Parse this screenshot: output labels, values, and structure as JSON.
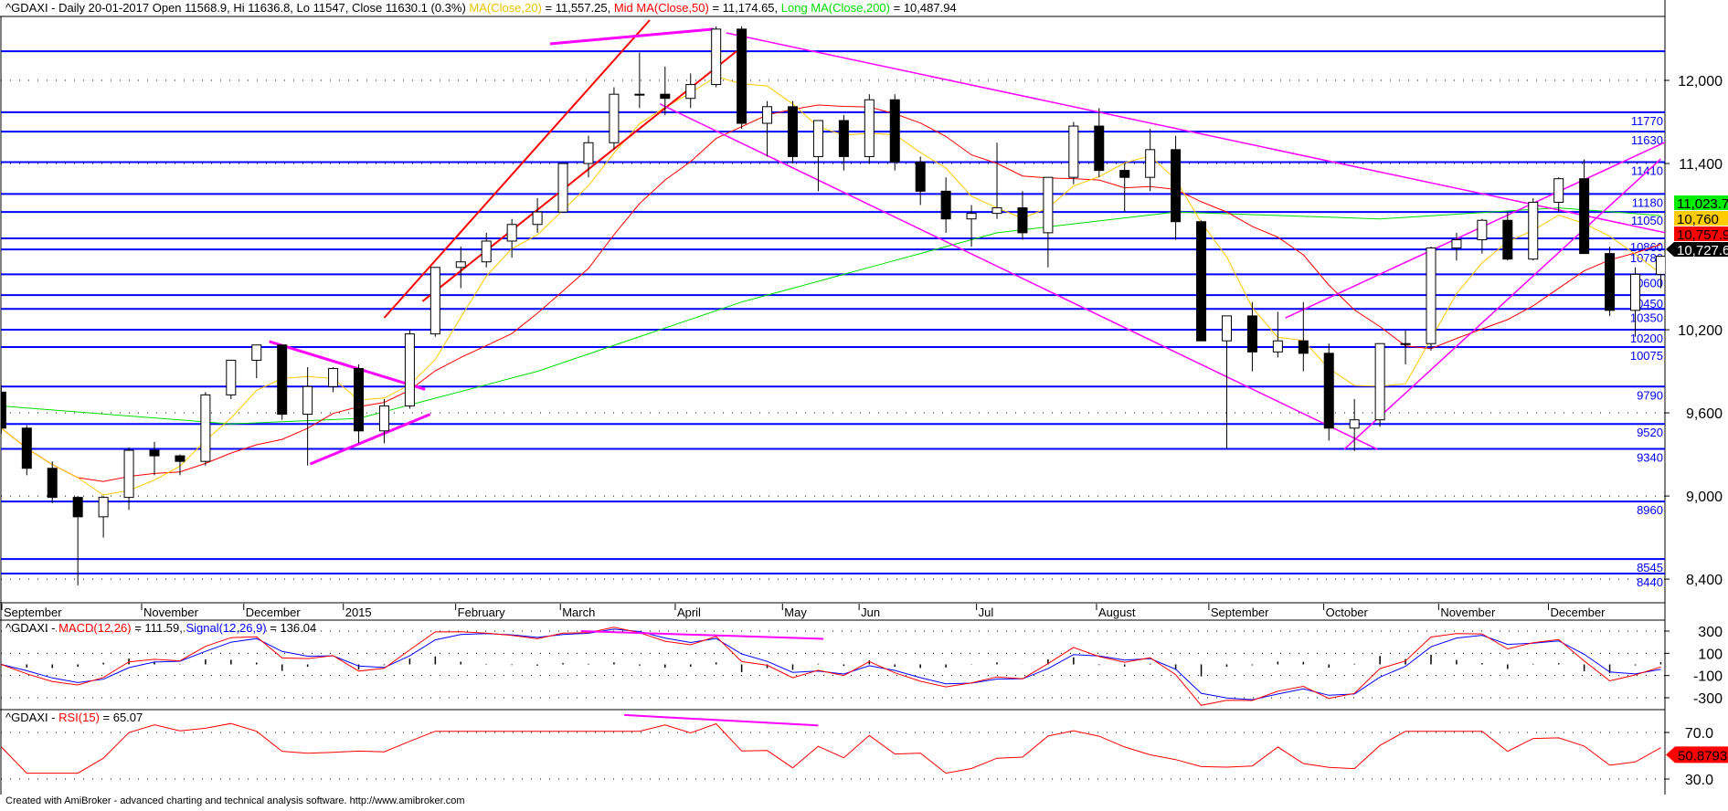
{
  "header": {
    "symbol_info": "^GDAXI - Daily 20-01-2017 Open 11568.9, Hi 11636.8, Lo 11547, Close 11630.1 (0.3%)",
    "ma20_label": "MA(Close,20)",
    "ma20_value": " = 11,557.25, ",
    "ma50_label": "Mid MA(Close,50)",
    "ma50_value": " = 11,174.65, ",
    "ma200_label": "Long MA(Close,200)",
    "ma200_value": " = 10,487.94"
  },
  "macd_header": {
    "prefix": "^GDAXI - ",
    "macd_label": "MACD(12,26)",
    "macd_value": " = 111.59, ",
    "signal_label": "Signal(12,26,9)",
    "signal_value": " = 136.04"
  },
  "rsi_header": {
    "prefix": "^GDAXI - ",
    "rsi_label": "RSI(15)",
    "rsi_value": " = 65.07"
  },
  "footer": "Created with AmiBroker - advanced charting and technical analysis software. http://www.amibroker.com",
  "colors": {
    "support": "#0000ff",
    "trend": "#ff00ff",
    "trend_red": "#ff0000",
    "ma20": "#ffc800",
    "ma50": "#ff0000",
    "ma200": "#00dd00",
    "macd": "#ff0000",
    "signal": "#0000ff",
    "rsi": "#ff0000"
  },
  "chart_data": {
    "type": "candlestick",
    "title": "^GDAXI - Daily",
    "period_unit": "week",
    "months": [
      {
        "label": "September",
        "week": 0.7
      },
      {
        "label": "November",
        "week": 7
      },
      {
        "label": "December",
        "week": 11
      },
      {
        "label": "2015",
        "week": 14.9
      },
      {
        "label": "February",
        "week": 19.3
      },
      {
        "label": "March",
        "week": 23.4
      },
      {
        "label": "April",
        "week": 27.9
      },
      {
        "label": "May",
        "week": 32.1
      },
      {
        "label": "Jun",
        "week": 35.1
      },
      {
        "label": "Jul",
        "week": 39.7
      },
      {
        "label": "August",
        "week": 44.4
      },
      {
        "label": "September",
        "week": 48.8
      },
      {
        "label": "October",
        "week": 53.3
      },
      {
        "label": "November",
        "week": 57.8
      },
      {
        "label": "December",
        "week": 62.1
      }
    ],
    "ohlc": [
      [
        9750,
        9800,
        9450,
        9490
      ],
      [
        9490,
        9510,
        9150,
        9200
      ],
      [
        9200,
        9250,
        8950,
        8990
      ],
      [
        8990,
        9000,
        8355,
        8850
      ],
      [
        8850,
        9000,
        8700,
        8990
      ],
      [
        8990,
        9350,
        8900,
        9330
      ],
      [
        9330,
        9390,
        9150,
        9290
      ],
      [
        9290,
        9300,
        9150,
        9250
      ],
      [
        9250,
        9750,
        9220,
        9730
      ],
      [
        9730,
        9980,
        9700,
        9980
      ],
      [
        9980,
        10090,
        9850,
        10090
      ],
      [
        10090,
        10090,
        9550,
        9590
      ],
      [
        9590,
        9930,
        9220,
        9790
      ],
      [
        9790,
        9930,
        9750,
        9920
      ],
      [
        9920,
        9950,
        9380,
        9470
      ],
      [
        9470,
        9700,
        9380,
        9650
      ],
      [
        9650,
        10200,
        9630,
        10170
      ],
      [
        10170,
        10650,
        10150,
        10650
      ],
      [
        10650,
        10800,
        10500,
        10690
      ],
      [
        10690,
        10900,
        10650,
        10840
      ],
      [
        10840,
        11000,
        10720,
        10960
      ],
      [
        10960,
        11150,
        10900,
        11050
      ],
      [
        11050,
        11400,
        11050,
        11400
      ],
      [
        11400,
        11600,
        11300,
        11550
      ],
      [
        11550,
        11950,
        11500,
        11900
      ],
      [
        11900,
        12200,
        11800,
        11900
      ],
      [
        11900,
        12100,
        11750,
        11870
      ],
      [
        11870,
        12050,
        11800,
        11970
      ],
      [
        11970,
        12390,
        11950,
        12370
      ],
      [
        12370,
        12390,
        11650,
        11690
      ],
      [
        11690,
        11850,
        11450,
        11810
      ],
      [
        11810,
        11850,
        11400,
        11450
      ],
      [
        11450,
        11500,
        11200,
        11710
      ],
      [
        11710,
        11750,
        11350,
        11450
      ],
      [
        11450,
        11900,
        11400,
        11860
      ],
      [
        11860,
        11900,
        11350,
        11410
      ],
      [
        11410,
        11450,
        11100,
        11200
      ],
      [
        11200,
        11300,
        10900,
        11000
      ],
      [
        11000,
        11100,
        10800,
        11040
      ],
      [
        11040,
        11550,
        11000,
        11080
      ],
      [
        11080,
        11200,
        10850,
        10900
      ],
      [
        10900,
        11300,
        10650,
        11300
      ],
      [
        11300,
        11700,
        11250,
        11670
      ],
      [
        11670,
        11800,
        11300,
        11350
      ],
      [
        11350,
        11400,
        11050,
        11300
      ],
      [
        11300,
        11650,
        11200,
        11500
      ],
      [
        11500,
        11600,
        10850,
        10980
      ],
      [
        10980,
        10990,
        10120,
        10120
      ],
      [
        10120,
        10300,
        9340,
        10300
      ],
      [
        10300,
        10400,
        9900,
        10040
      ],
      [
        10040,
        10330,
        10000,
        10120
      ],
      [
        10120,
        10400,
        9900,
        10030
      ],
      [
        10030,
        10100,
        9400,
        9490
      ],
      [
        9490,
        9700,
        9325,
        9550
      ],
      [
        9550,
        10100,
        9500,
        10100
      ],
      [
        10100,
        10200,
        9950,
        10100
      ],
      [
        10100,
        10800,
        10050,
        10790
      ],
      [
        10790,
        10900,
        10700,
        10850
      ],
      [
        10850,
        11000,
        10750,
        10990
      ],
      [
        10990,
        11050,
        10700,
        10710
      ],
      [
        10710,
        11150,
        10700,
        11120
      ],
      [
        11120,
        11300,
        11050,
        11290
      ],
      [
        11290,
        11430,
        10750,
        10750
      ],
      [
        10750,
        10800,
        10300,
        10340
      ],
      [
        10340,
        10650,
        10150,
        10600
      ],
      [
        10600,
        10730,
        10500,
        10730
      ]
    ],
    "ma200_points": [
      [
        1,
        9650
      ],
      [
        10,
        9520
      ],
      [
        15,
        9560
      ],
      [
        22,
        9900
      ],
      [
        30,
        10400
      ],
      [
        40,
        10900
      ],
      [
        47,
        11050
      ],
      [
        55,
        11000
      ],
      [
        62,
        11080
      ],
      [
        66,
        11024
      ]
    ],
    "support_levels": [
      12210,
      11770,
      11630,
      11410,
      11180,
      11050,
      10860,
      10780,
      10600,
      10450,
      10350,
      10200,
      10075,
      9790,
      9520,
      9340,
      8960,
      8545,
      8440
    ],
    "support_labels": [
      "",
      "11770",
      "11630",
      "11410",
      "11180",
      "11050",
      "10860",
      "10780",
      "10600",
      "10450",
      "10350",
      "10200",
      "10075",
      "9790",
      "9520",
      "9340",
      "8960",
      "8545",
      "8440"
    ],
    "trendlines": [
      {
        "color": "red",
        "points": [
          [
            17.5,
            10405
          ],
          [
            29.8,
            12210
          ]
        ]
      },
      {
        "color": "red",
        "points": [
          [
            16,
            10286
          ],
          [
            26.4,
            12435
          ]
        ]
      },
      {
        "color": "pink",
        "points": [
          [
            29.4,
            12343
          ],
          [
            66.7,
            10880
          ]
        ]
      },
      {
        "color": "pink",
        "points": [
          [
            26.8,
            11830
          ],
          [
            54.9,
            9337
          ]
        ]
      },
      {
        "color": "pink",
        "points": [
          [
            53.6,
            9337
          ],
          [
            66,
            11433
          ]
        ]
      },
      {
        "color": "pink",
        "points": [
          [
            51.3,
            10286
          ],
          [
            66.6,
            11590
          ]
        ]
      },
      {
        "color": "pink",
        "points": [
          [
            11.5,
            10115
          ],
          [
            17.6,
            9770
          ]
        ]
      },
      {
        "color": "pink",
        "points": [
          [
            13.1,
            9231
          ],
          [
            17.8,
            9590
          ]
        ]
      },
      {
        "color": "pink",
        "points": [
          [
            22.5,
            12264
          ],
          [
            28.9,
            12370
          ]
        ]
      }
    ],
    "macd_trendline": [
      [
        23.7,
        300
      ],
      [
        33.2,
        230
      ]
    ],
    "rsi_trendline": [
      [
        25.4,
        85
      ],
      [
        33.0,
        76
      ]
    ],
    "price_axis": {
      "ticks": [
        "12,000",
        "11,400",
        "10,200",
        "9,600",
        "9,000",
        "8,400"
      ],
      "values": [
        12000,
        11400,
        10200,
        9600,
        9000,
        8400
      ]
    },
    "macd_axis": {
      "ticks": [
        "300",
        "100",
        "-100",
        "-300"
      ],
      "values": [
        300,
        100,
        -100,
        -300
      ]
    },
    "rsi_axis": {
      "ticks": [
        "70.0",
        "30.0"
      ],
      "values": [
        70,
        30
      ]
    },
    "last_values": [
      {
        "label": "11,023.7",
        "value": 11023.7,
        "color": "#00ee00"
      },
      {
        "label": "10,760",
        "value": 10760,
        "color": "#ffcc00"
      },
      {
        "label": "10,757.9",
        "value": 10757.9,
        "color": "#ff0000"
      },
      {
        "label": "10,727.6",
        "value": 10727.6,
        "color": "#000000"
      }
    ],
    "rsi_last": {
      "label": "50.8793",
      "value": 50.8793
    }
  }
}
